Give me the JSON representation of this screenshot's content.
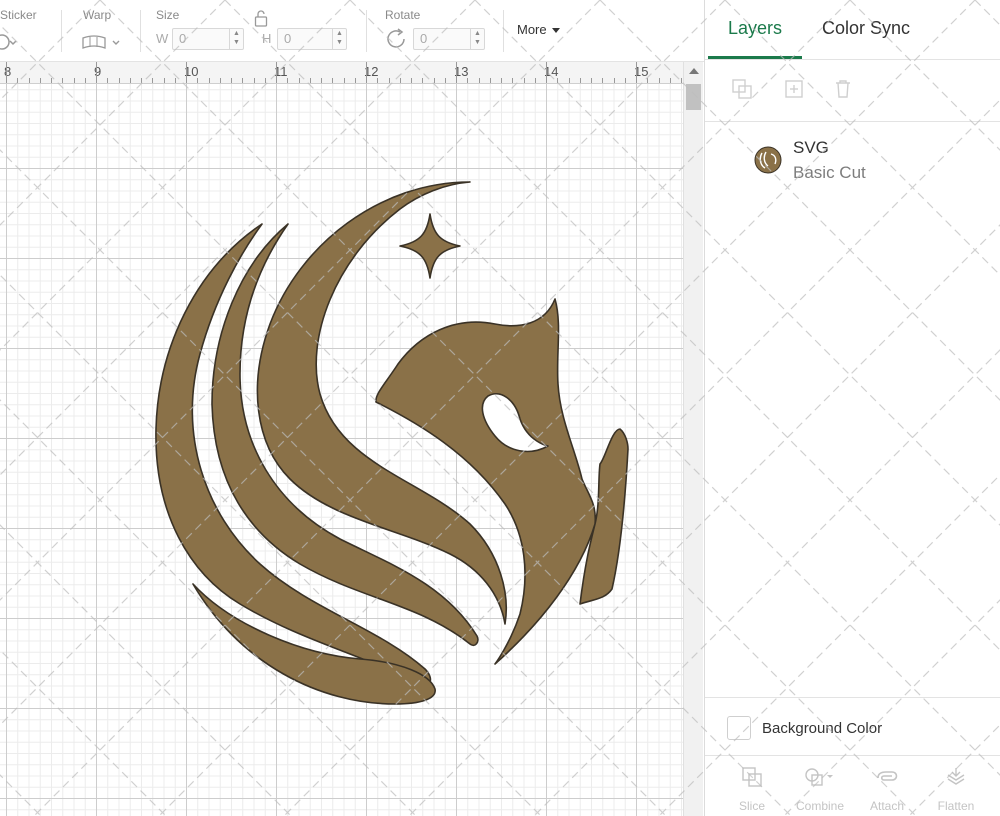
{
  "toolbar": {
    "sticker_label": "Sticker",
    "warp_label": "Warp",
    "size_label": "Size",
    "size_w_letter": "W",
    "size_w_value": "0",
    "size_h_letter": "H",
    "size_h_value": "0",
    "rotate_label": "Rotate",
    "rotate_value": "0",
    "more_label": "More"
  },
  "ruler": {
    "numbers": [
      "8",
      "9",
      "10",
      "11",
      "12",
      "13",
      "14",
      "15"
    ]
  },
  "panel": {
    "tabs": [
      {
        "label": "Layers",
        "active": true
      },
      {
        "label": "Color Sync",
        "active": false
      }
    ],
    "layer": {
      "name": "SVG",
      "operation": "Basic Cut",
      "color": "#8a7148"
    },
    "background_color_label": "Background Color",
    "bottom_tools": [
      {
        "label": "Slice",
        "icon": "slice-icon"
      },
      {
        "label": "Combine",
        "icon": "combine-icon"
      },
      {
        "label": "Attach",
        "icon": "attach-icon"
      },
      {
        "label": "Flatten",
        "icon": "flatten-icon"
      }
    ]
  },
  "colors": {
    "accent": "#1b7a4b",
    "logo_fill": "#8a7148",
    "logo_stroke": "#3a3226"
  }
}
